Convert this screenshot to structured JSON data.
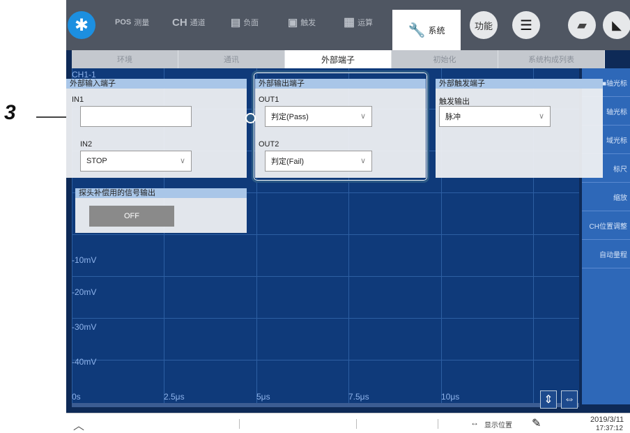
{
  "toolbar": {
    "gear_icon": "gear-icon",
    "items": [
      {
        "icon": "POS",
        "label": "测量"
      },
      {
        "icon": "CH",
        "label": "通道"
      },
      {
        "icon": "▤",
        "label": "负面"
      },
      {
        "icon": "▣",
        "label": "触发"
      },
      {
        "icon": "▦",
        "label": "运算"
      }
    ],
    "system_label": "系统",
    "function_label": "功能"
  },
  "subtabs": [
    "环境",
    "通讯",
    "外部端子",
    "初始化",
    "系统构成列表"
  ],
  "active_subtab": "外部端子",
  "plot": {
    "ch_label": "CH1-1",
    "y_labels": [
      "-10mV",
      "-20mV",
      "-30mV",
      "-40mV"
    ],
    "x_labels": [
      "0s",
      "2.5μs",
      "5μs",
      "7.5μs",
      "10μs"
    ]
  },
  "right_panel": [
    "■轴光标",
    "轴光标",
    "域光标",
    "标尺",
    "缩放",
    "CH位置调整",
    "自动量程"
  ],
  "ext_input": {
    "title": "外部输入端子",
    "in1_label": "IN1",
    "in1_value": "",
    "in2_label": "IN2",
    "in2_value": "STOP"
  },
  "ext_output": {
    "title": "外部输出端子",
    "out1_label": "OUT1",
    "out1_value": "判定(Pass)",
    "out2_label": "OUT2",
    "out2_value": "判定(Fail)"
  },
  "ext_trigger": {
    "title": "外部触发端子",
    "trig_label": "触发输出",
    "trig_value": "脉冲"
  },
  "probe": {
    "title": "探头补偿用的信号输出",
    "button": "OFF"
  },
  "status": {
    "display_position": "显示位置",
    "date": "2019/3/11",
    "time": "17:37:12"
  },
  "callout": "3"
}
